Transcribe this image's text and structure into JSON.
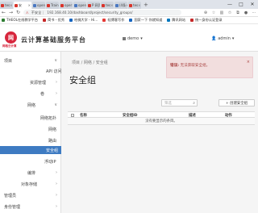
{
  "browser": {
    "tabs": [
      {
        "label": "tes",
        "active": false
      },
      {
        "label": "安",
        "active": true
      },
      {
        "label": "open",
        "active": false
      },
      {
        "label": "Train",
        "active": false
      },
      {
        "label": "oper",
        "active": false
      },
      {
        "label": "open",
        "active": false
      },
      {
        "label": "P 网页",
        "active": false
      },
      {
        "label": "tes",
        "active": false
      },
      {
        "label": "(4条",
        "active": false
      },
      {
        "label": "tes",
        "active": false
      }
    ],
    "new_tab": "+",
    "window_controls": [
      "—",
      "□",
      "✕"
    ],
    "security_label": "不安全",
    "url": "192.168.40.10/dashboard/project/security_groups/",
    "bookmarks": [
      {
        "label": "THEOL在线教学平台",
        "color": "#2e7d32"
      },
      {
        "label": "简书 - 优秀",
        "color": "#c62828"
      },
      {
        "label": "哈佛大学 - Hi…",
        "color": "#1565c0"
      },
      {
        "label": "轻博客写作",
        "color": "#e53935"
      },
      {
        "label": "国家一下 你就知道",
        "color": "#1565c0"
      },
      {
        "label": "腾讯网站",
        "color": "#0277bd"
      },
      {
        "label": "统一身份认证登录",
        "color": "#c62828"
      }
    ]
  },
  "header": {
    "logo_initial": "网",
    "logo_text": "网格云计算",
    "brand": "云计算基础服务平台",
    "project": "demo",
    "user": "admin",
    "caret": "▾"
  },
  "sidebar": {
    "items": [
      {
        "label": "项目",
        "chevron": "∨",
        "indent": 5
      },
      {
        "label": "API 访问",
        "chevron": "",
        "indent": 57
      },
      {
        "label": "资源管理",
        "chevron": "›",
        "indent": 37
      },
      {
        "label": "卷",
        "chevron": "›",
        "indent": 50
      },
      {
        "label": "网络",
        "chevron": "∨",
        "indent": 34
      },
      {
        "label": "网络拓扑",
        "chevron": "",
        "indent": 50
      },
      {
        "label": "网络",
        "chevron": "",
        "indent": 60
      },
      {
        "label": "路由",
        "chevron": "",
        "indent": 60
      },
      {
        "label": "安全组",
        "chevron": "",
        "indent": 57,
        "active": true
      },
      {
        "label": "浮动IP",
        "chevron": "",
        "indent": 55
      },
      {
        "label": "编排",
        "chevron": "›",
        "indent": 34
      },
      {
        "label": "对象存储",
        "chevron": "›",
        "indent": 26
      },
      {
        "label": "管理员",
        "chevron": "›",
        "indent": 5
      },
      {
        "label": "身份管理",
        "chevron": "›",
        "indent": 5
      }
    ]
  },
  "main": {
    "breadcrumb": "项目 / 网络 / 安全组",
    "title": "安全组",
    "alert": {
      "prefix": "错误:",
      "message": "无法获取安全组。",
      "close": "×"
    },
    "filter_placeholder": "筛选",
    "create_button": "+ 创建安全组",
    "table": {
      "columns": [
        "名称",
        "安全组ID",
        "描述",
        "动作"
      ],
      "empty_text": "没有要显示的条目。"
    }
  }
}
